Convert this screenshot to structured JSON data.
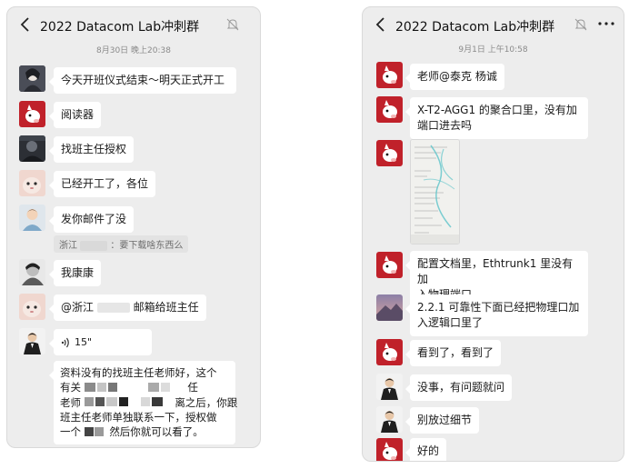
{
  "left": {
    "title": "2022 Datacom Lab冲刺群",
    "timestamp": "8月30日 晚上20:38",
    "messages": [
      {
        "text": "今天开班仪式结束～明天正式开工"
      },
      {
        "text": "阅读器"
      },
      {
        "text": "找班主任授权"
      },
      {
        "text": "已经开工了，各位"
      },
      {
        "text": "发你邮件了没"
      },
      {
        "quote": {
          "prefix": "浙江",
          "suffix": "：要下载啥东西么"
        }
      },
      {
        "text": "我康康"
      },
      {
        "text": {
          "prefix": "@浙江",
          "suffix": "邮箱给班主任"
        }
      },
      {
        "voice": "15\""
      },
      {
        "lines": [
          "资料没有的找班主任老师好，这个",
          "有关",
          "任",
          "老师",
          "离之后，你跟",
          "班主任老师单独联系一下，授权做",
          "一个",
          "然后你就可以看了。"
        ]
      }
    ]
  },
  "right": {
    "title": "2022 Datacom Lab冲刺群",
    "timestamp": "9月1日 上午10:58",
    "messages": [
      {
        "text": "老师@泰克 杨诚"
      },
      {
        "lines": [
          "X-T2-AGG1 的聚合口里，没有加",
          "端口进去吗"
        ]
      },
      {
        "image": "document-photo"
      },
      {
        "lines": [
          "配置文档里，Ethtrunk1 里没有加",
          "入物理端口"
        ]
      },
      {
        "lines": [
          "2.2.1 可靠性下面已经把物理口加",
          "入逻辑口里了"
        ]
      },
      {
        "text": "看到了，看到了"
      },
      {
        "text": "没事，有问题就问"
      },
      {
        "text": "别放过细节"
      },
      {
        "text": "好的"
      }
    ]
  },
  "colors": {
    "chat_bg": "#ededed",
    "bubble": "#ffffff",
    "avatar_red": "#c0212a"
  }
}
